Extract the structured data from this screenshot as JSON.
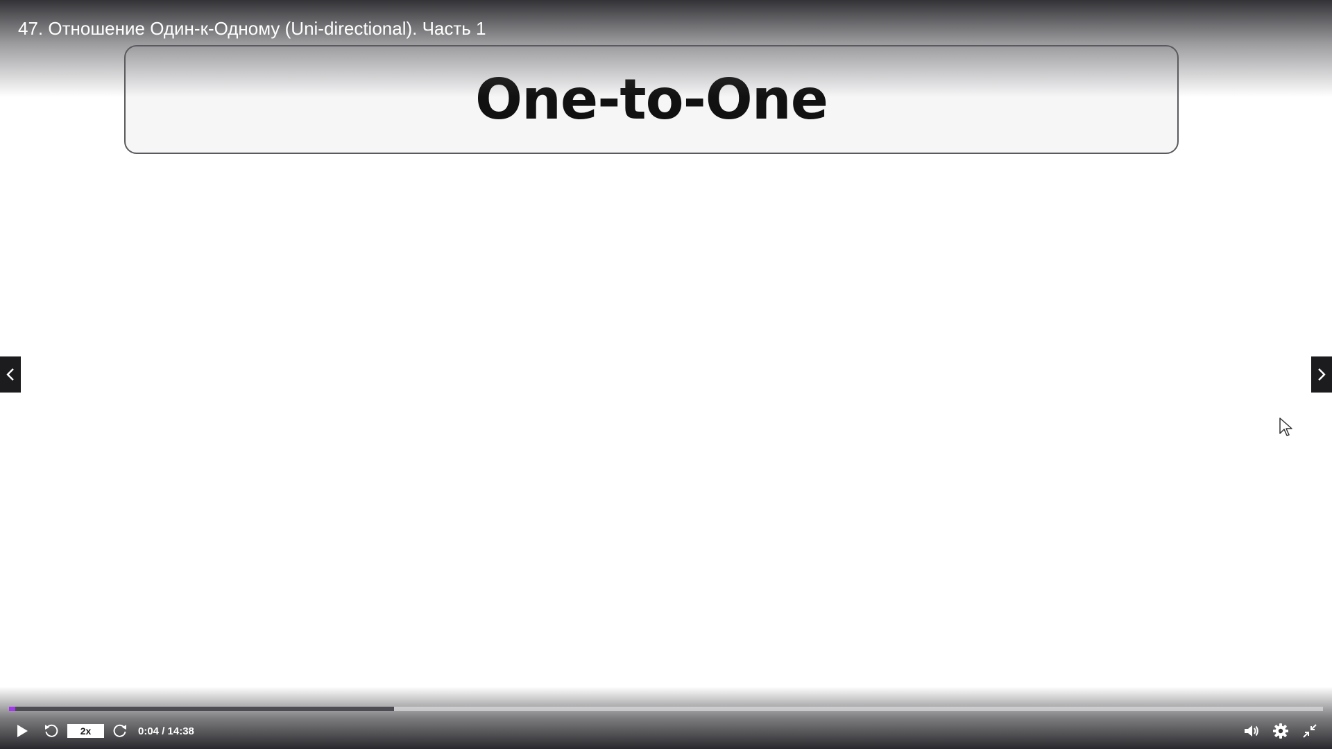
{
  "player": {
    "title": "47. Отношение Один-к-Одному (Uni-directional). Часть 1",
    "slide_heading": "One-to-One",
    "controls": {
      "playback_speed": "2x",
      "current_time": "0:04",
      "duration": "14:38",
      "time_text": "0:04 / 14:38",
      "played_fraction": 0.005,
      "buffered_fraction": 0.293,
      "play_icon": "play-icon",
      "rewind_icon": "rewind-5-icon",
      "forward_icon": "forward-5-icon",
      "volume_icon": "volume-icon",
      "settings_icon": "gear-icon",
      "fullscreen_icon": "exit-fullscreen-icon"
    },
    "navigation": {
      "prev_icon": "chevron-left-icon",
      "next_icon": "chevron-right-icon"
    }
  },
  "colors": {
    "accent": "#a435f0",
    "control_bar": "#1c1c1e",
    "banner_border": "#5a5a5e"
  }
}
